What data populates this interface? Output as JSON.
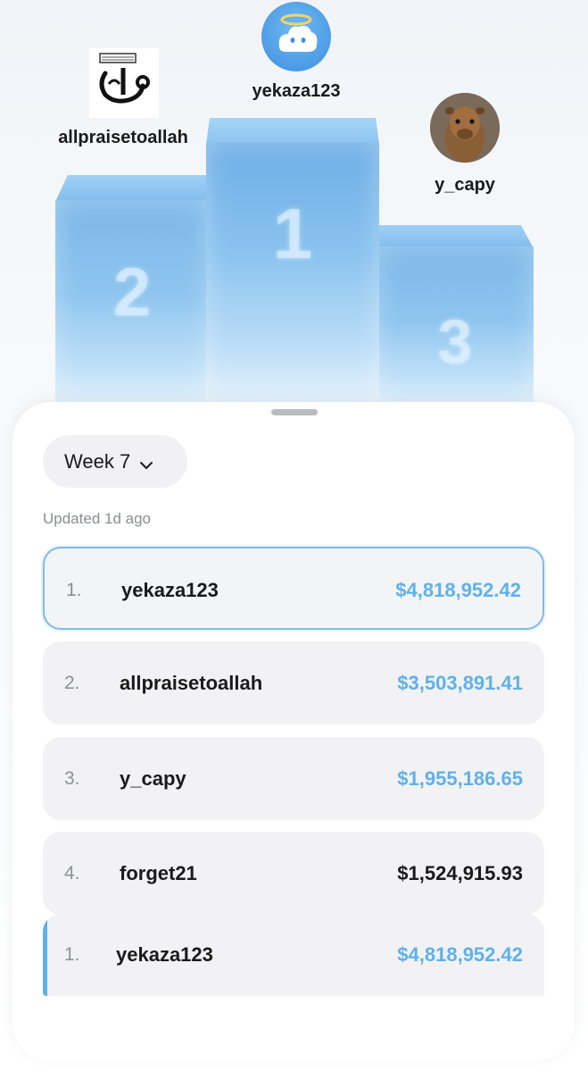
{
  "podium": {
    "first": {
      "rank_digit": "1",
      "username": "yekaza123",
      "avatar_icon": "cloud-halo-icon"
    },
    "second": {
      "rank_digit": "2",
      "username": "allpraisetoallah",
      "avatar_icon": "calligraphy-logo-icon"
    },
    "third": {
      "rank_digit": "3",
      "username": "y_capy",
      "avatar_icon": "capybara-photo-icon"
    }
  },
  "sheet": {
    "week_label": "Week 7",
    "updated_text": "Updated 1d ago"
  },
  "leaderboard": [
    {
      "rank": "1.",
      "name": "yekaza123",
      "amount": "$4,818,952.42"
    },
    {
      "rank": "2.",
      "name": "allpraisetoallah",
      "amount": "$3,503,891.41"
    },
    {
      "rank": "3.",
      "name": "y_capy",
      "amount": "$1,955,186.65"
    },
    {
      "rank": "4.",
      "name": "forget21",
      "amount": "$1,524,915.93"
    }
  ],
  "pinned_user": {
    "rank": "1.",
    "name": "yekaza123",
    "amount": "$4,818,952.42"
  },
  "colors": {
    "accent_blue": "#5fb1e9",
    "podium_blue": "#82bcec",
    "row_background": "#f2f2f4"
  }
}
